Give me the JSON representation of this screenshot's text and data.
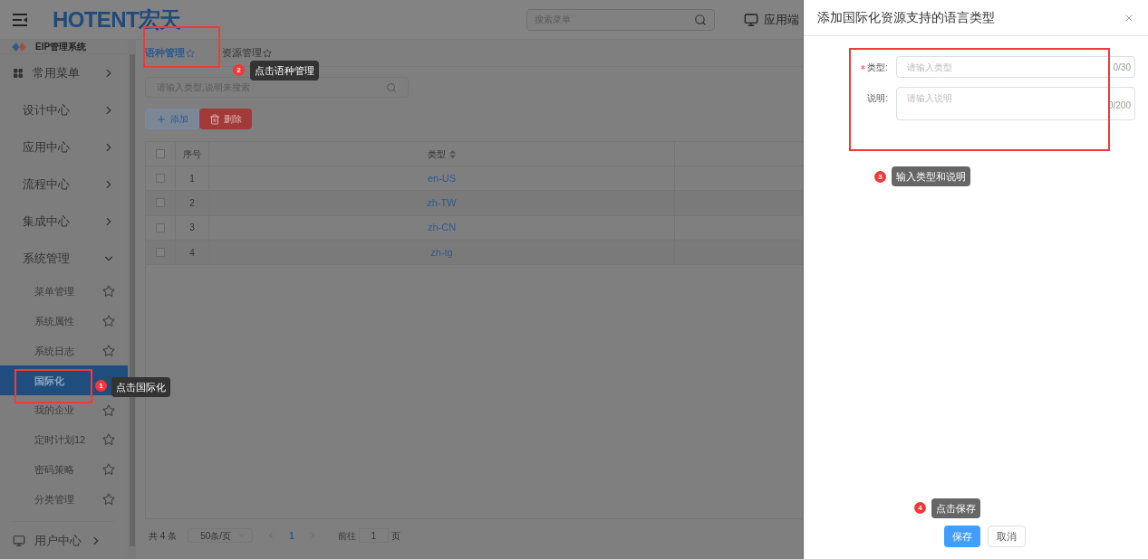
{
  "header": {
    "logo": "HOTENT宏天",
    "search": {
      "placeholder": "搜索菜单"
    },
    "app_link": "应用端"
  },
  "sidebar": {
    "title": "EIP管理系统",
    "items": [
      {
        "label": "常用菜单",
        "kind": "favorites",
        "expanded": false
      },
      {
        "label": "设计中心",
        "kind": "group",
        "expanded": false
      },
      {
        "label": "应用中心",
        "kind": "group",
        "expanded": false
      },
      {
        "label": "流程中心",
        "kind": "group",
        "expanded": false
      },
      {
        "label": "集成中心",
        "kind": "group",
        "expanded": false
      },
      {
        "label": "系统管理",
        "kind": "group",
        "expanded": true,
        "children": [
          {
            "label": "菜单管理",
            "selected": false
          },
          {
            "label": "系统属性",
            "selected": false
          },
          {
            "label": "系统日志",
            "selected": false
          },
          {
            "label": "国际化",
            "selected": true
          },
          {
            "label": "我的企业",
            "selected": false
          },
          {
            "label": "定时计划12",
            "selected": false
          },
          {
            "label": "密码策略",
            "selected": false
          },
          {
            "label": "分类管理",
            "selected": false
          }
        ]
      },
      {
        "label": "用户中心",
        "kind": "user",
        "expanded": false
      }
    ]
  },
  "tabs": [
    {
      "label": "语种管理",
      "selected": true
    },
    {
      "label": "资源管理",
      "selected": false
    }
  ],
  "toolbar": {
    "search": {
      "placeholder": "请输入类型,说明来搜索"
    },
    "buttons": [
      {
        "label": "添加",
        "kind": "add"
      },
      {
        "label": "删除",
        "kind": "delete"
      }
    ]
  },
  "table": {
    "all_checked": false,
    "columns": [
      {
        "label": "序号",
        "sortable": false
      },
      {
        "label": "类型",
        "sortable": true
      }
    ],
    "rows": [
      {
        "index": "1",
        "type": "en-US",
        "checked": false
      },
      {
        "index": "2",
        "type": "zh-TW",
        "checked": false
      },
      {
        "index": "3",
        "type": "zh-CN",
        "checked": false
      },
      {
        "index": "4",
        "type": "zh-tg",
        "checked": false
      }
    ]
  },
  "pagination": {
    "total": "共 4 条",
    "page_size": "50条/页",
    "pages": [
      {
        "label": "1",
        "selected": true
      }
    ],
    "goto_label": "前往",
    "goto_value": "1",
    "page_suffix": "页"
  },
  "drawer": {
    "title": "添加国际化资源支持的语言类型",
    "fields": [
      {
        "label": "类型:",
        "required": true,
        "kind": "input",
        "placeholder": "请输入类型",
        "counter": "0/30"
      },
      {
        "label": "说明:",
        "required": false,
        "kind": "textarea",
        "placeholder": "请输入说明",
        "counter": "0/200"
      }
    ],
    "buttons": [
      {
        "label": "保存",
        "kind": "primary"
      },
      {
        "label": "取消",
        "kind": "default"
      }
    ]
  },
  "annotations": [
    {
      "number": "1",
      "text": "点击国际化"
    },
    {
      "number": "2",
      "text": "点击语种管理"
    },
    {
      "number": "3",
      "text": "输入类型和说明"
    },
    {
      "number": "4",
      "text": "点击保存"
    }
  ]
}
